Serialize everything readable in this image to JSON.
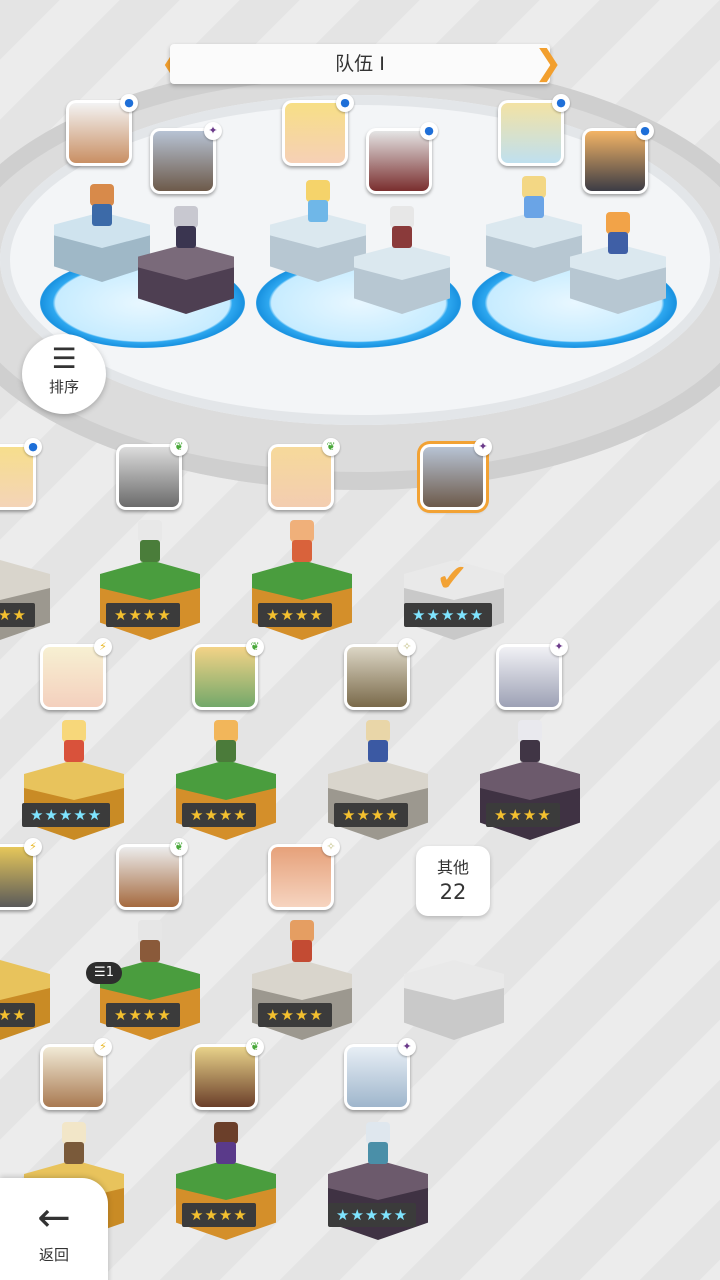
{
  "header": {
    "title": "队伍 I",
    "left_arrow": "❮",
    "right_arrow": "❯"
  },
  "sort_button": {
    "icon": "sort-icon",
    "label": "排序"
  },
  "back_button": {
    "icon": "back-arrow-icon",
    "label": "返回"
  },
  "other_count": {
    "label": "其他",
    "value": "22"
  },
  "copy_badge": "1",
  "team": [
    {
      "slot": 1,
      "element": "blue-circle"
    },
    {
      "slot": 2,
      "element": "purple-star"
    },
    {
      "slot": 3,
      "element": "blue-circle"
    },
    {
      "slot": 4,
      "element": "blue-circle"
    },
    {
      "slot": 5,
      "element": "blue-circle"
    },
    {
      "slot": 6,
      "element": "blue-circle"
    }
  ],
  "heroes": [
    {
      "row": 1,
      "col": 0,
      "stars": 5,
      "star_color": "gold",
      "element": "blue-circle",
      "selected": false
    },
    {
      "row": 1,
      "col": 1,
      "stars": 4,
      "star_color": "gold",
      "element": "green-leaf",
      "selected": false
    },
    {
      "row": 1,
      "col": 2,
      "stars": 4,
      "star_color": "gold",
      "element": "green-leaf",
      "selected": false
    },
    {
      "row": 1,
      "col": 3,
      "stars": 5,
      "star_color": "rainbow",
      "element": "purple-star",
      "selected": true
    },
    {
      "row": 2,
      "col": 0,
      "stars": 5,
      "star_color": "rainbow",
      "element": "yellow-bolt",
      "selected": false
    },
    {
      "row": 2,
      "col": 1,
      "stars": 4,
      "star_color": "gold",
      "element": "green-leaf",
      "selected": false
    },
    {
      "row": 2,
      "col": 2,
      "stars": 4,
      "star_color": "gold",
      "element": "white-sparkle",
      "selected": false
    },
    {
      "row": 2,
      "col": 3,
      "stars": 4,
      "star_color": "gold",
      "element": "purple-star",
      "selected": false
    },
    {
      "row": 3,
      "col": 0,
      "stars": 4,
      "star_color": "gold",
      "element": "yellow-bolt",
      "selected": false
    },
    {
      "row": 3,
      "col": 1,
      "stars": 4,
      "star_color": "gold",
      "element": "green-leaf",
      "selected": false
    },
    {
      "row": 3,
      "col": 2,
      "stars": 4,
      "star_color": "gold",
      "element": "white-sparkle",
      "selected": false
    },
    {
      "row": 4,
      "col": 0,
      "stars": 4,
      "star_color": "gold",
      "element": "yellow-bolt",
      "selected": false
    },
    {
      "row": 4,
      "col": 1,
      "stars": 4,
      "star_color": "gold",
      "element": "green-leaf",
      "selected": false
    },
    {
      "row": 4,
      "col": 2,
      "stars": 5,
      "star_color": "rainbow",
      "element": "purple-star",
      "selected": false
    }
  ],
  "star_text": {
    "four": "★★★★",
    "five": "★★★★★",
    "partial": "★★"
  },
  "colors": {
    "accent": "#f2a234",
    "ring_blue": "#1992e0",
    "panel": "#ffffff"
  }
}
